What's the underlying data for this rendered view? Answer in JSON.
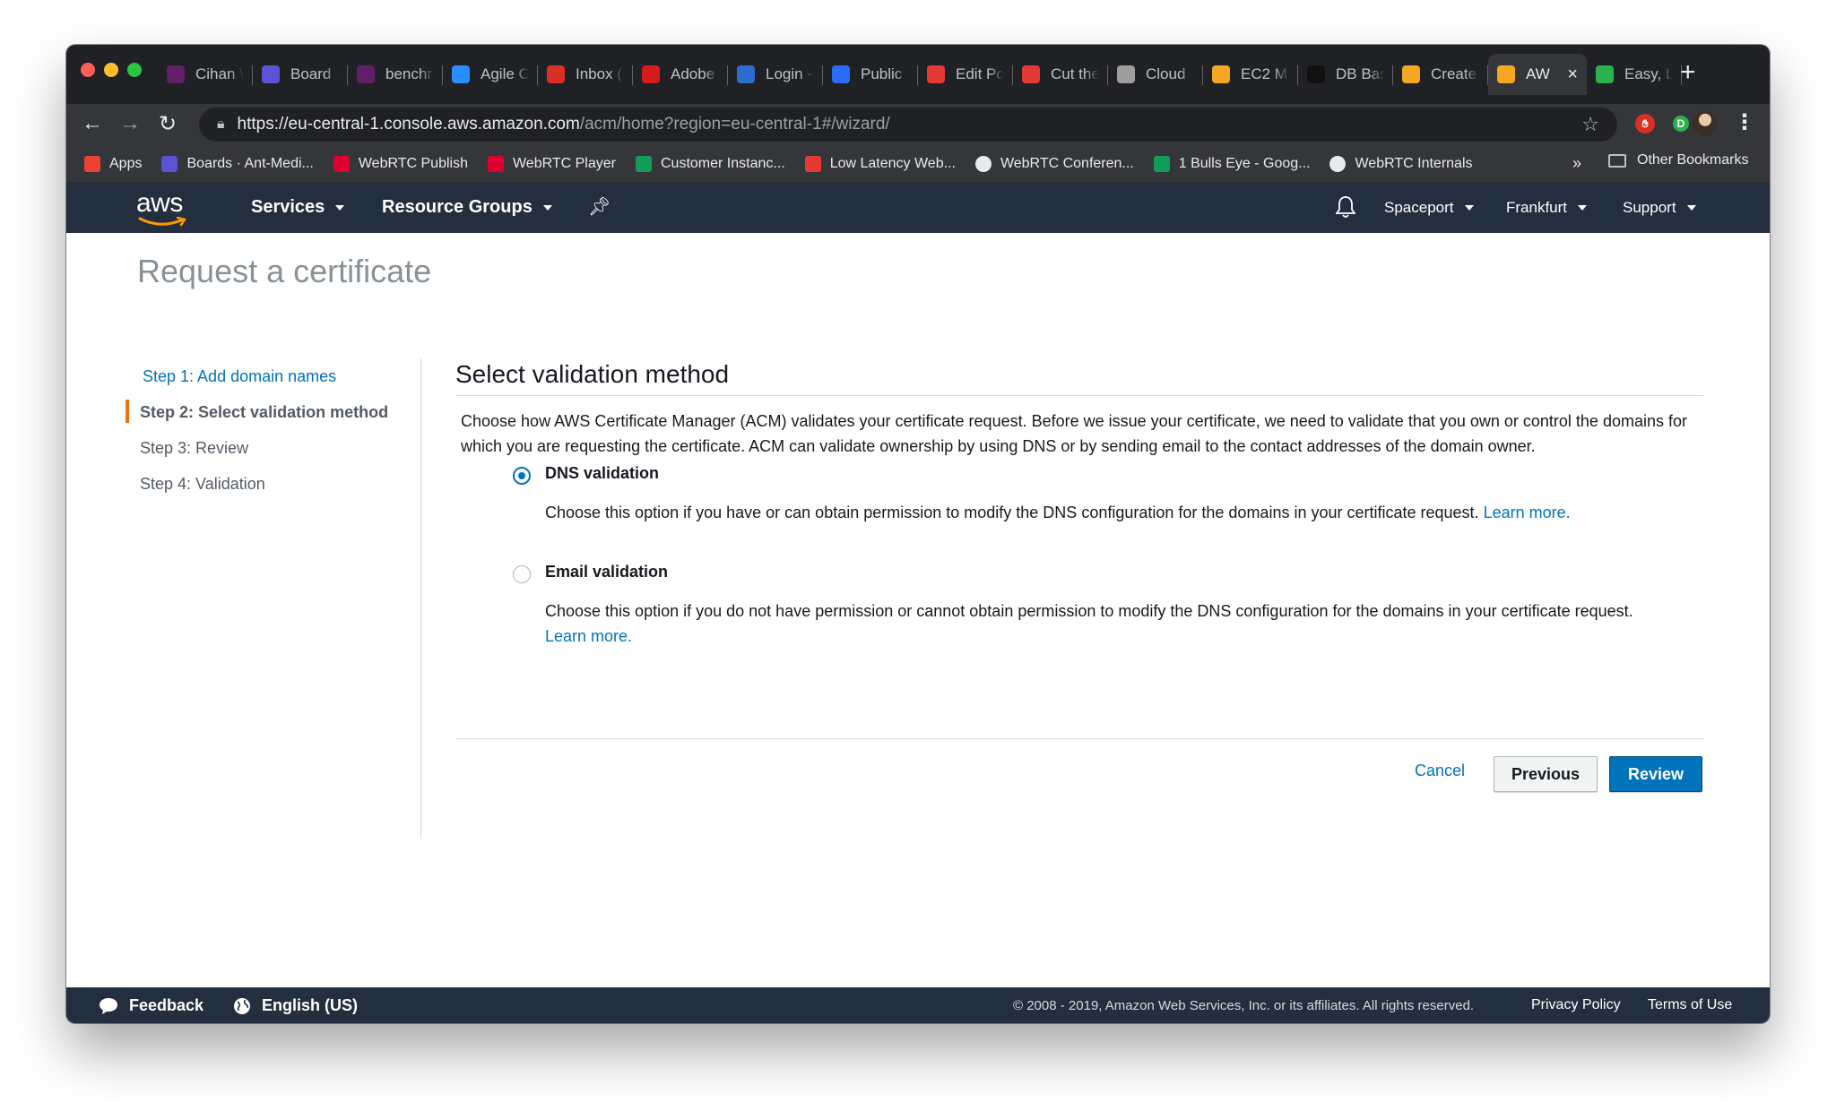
{
  "browser": {
    "tabs": [
      {
        "title": "Cihan \\",
        "icon": "slack-icon",
        "color": "#611f69"
      },
      {
        "title": "Board ·",
        "icon": "zenhub-icon",
        "color": "#5a55d6"
      },
      {
        "title": "benchr",
        "icon": "slack-icon",
        "color": "#611f69"
      },
      {
        "title": "Agile C",
        "icon": "cloud-icon",
        "color": "#2d8cff"
      },
      {
        "title": "Inbox (",
        "icon": "gmail-icon",
        "color": "#d93025"
      },
      {
        "title": "Adobe",
        "icon": "adobe-icon",
        "color": "#d61b1f"
      },
      {
        "title": "Login -",
        "icon": "globe-icon",
        "color": "#2d6bcf"
      },
      {
        "title": "Public",
        "icon": "wave-icon",
        "color": "#2b6cf6"
      },
      {
        "title": "Edit Po",
        "icon": "red5-icon",
        "color": "#e53935"
      },
      {
        "title": "Cut the",
        "icon": "red5-icon",
        "color": "#e53935"
      },
      {
        "title": "Cloud",
        "icon": "doc-icon",
        "color": "#9e9e9e"
      },
      {
        "title": "EC2 M",
        "icon": "aws-box-icon",
        "color": "#f5a623"
      },
      {
        "title": "DB Bas",
        "icon": "github-icon",
        "color": "#111111"
      },
      {
        "title": "Create",
        "icon": "aws-box-icon",
        "color": "#f5a623"
      },
      {
        "title": "AW",
        "icon": "aws-box-icon",
        "color": "#f5a623",
        "active": true
      },
      {
        "title": "Easy, L",
        "icon": "letsencrypt-icon",
        "color": "#2bb24c"
      }
    ],
    "url_host": "https://eu-central-1.console.aws.amazon.com",
    "url_path": "/acm/home?region=eu-central-1#/wizard/",
    "bookmarks": [
      {
        "label": "Apps",
        "icon": "apps-grid-icon",
        "color": "#ea4335"
      },
      {
        "label": "Boards · Ant-Medi...",
        "icon": "zenhub-icon",
        "color": "#5a55d6"
      },
      {
        "label": "WebRTC Publish",
        "icon": "angular-icon",
        "color": "#dd0031"
      },
      {
        "label": "WebRTC Player",
        "icon": "angular-icon",
        "color": "#dd0031"
      },
      {
        "label": "Customer Instanc...",
        "icon": "sheets-icon",
        "color": "#0f9d58"
      },
      {
        "label": "Low Latency Web...",
        "icon": "red5-icon",
        "color": "#e53935"
      },
      {
        "label": "WebRTC Conferen...",
        "icon": "globe-icon",
        "color": "#e8eaed"
      },
      {
        "label": "1 Bulls Eye - Goog...",
        "icon": "sheets-icon",
        "color": "#0f9d58"
      },
      {
        "label": "WebRTC Internals",
        "icon": "globe-icon",
        "color": "#e8eaed"
      }
    ],
    "more_label": "»",
    "other_bookmarks": "Other Bookmarks"
  },
  "aws_header": {
    "logo": "aws",
    "services": "Services",
    "resource_groups": "Resource Groups",
    "account": "Spaceport",
    "region": "Frankfurt",
    "support": "Support"
  },
  "page": {
    "title": "Request a certificate",
    "steps": [
      "Step 1: Add domain names",
      "Step 2: Select validation method",
      "Step 3: Review",
      "Step 4: Validation"
    ],
    "section_title": "Select validation method",
    "intro": "Choose how AWS Certificate Manager (ACM) validates your certificate request. Before we issue your certificate, we need to validate that you own or control the domains for which you are requesting the certificate. ACM can validate ownership by using DNS or by sending email to the contact addresses of the domain owner.",
    "options": [
      {
        "label": "DNS validation",
        "selected": true,
        "description": "Choose this option if you have or can obtain permission to modify the DNS configuration for the domains in your certificate request.",
        "link": "Learn more."
      },
      {
        "label": "Email validation",
        "selected": false,
        "description": "Choose this option if you do not have permission or cannot obtain permission to modify the DNS configuration for the domains in your certificate request.",
        "link": "Learn more."
      }
    ],
    "cancel": "Cancel",
    "previous": "Previous",
    "review": "Review"
  },
  "footer": {
    "feedback": "Feedback",
    "language": "English (US)",
    "copyright": "© 2008 - 2019, Amazon Web Services, Inc. or its affiliates. All rights reserved.",
    "privacy": "Privacy Policy",
    "terms": "Terms of Use"
  },
  "colors": {
    "aws_navy": "#232f3e",
    "link_blue": "#0073bb",
    "active_step_accent": "#ec7211"
  }
}
